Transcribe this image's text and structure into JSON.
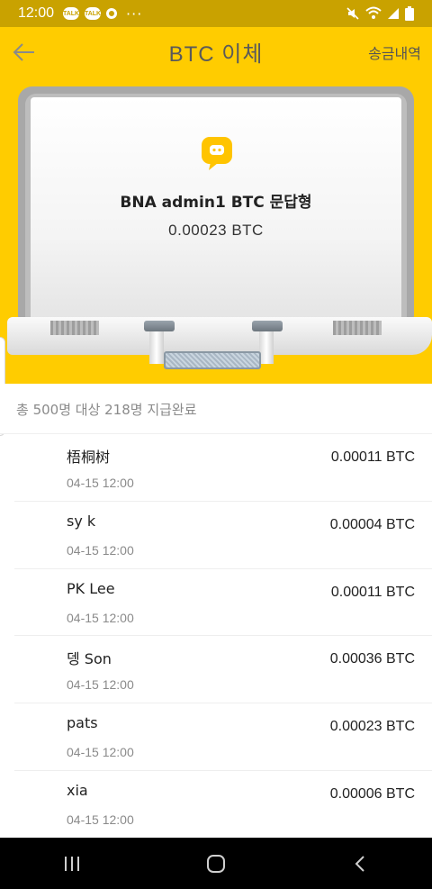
{
  "status": {
    "time": "12:00",
    "left_badges": [
      "TALK",
      "TALK"
    ],
    "dots": "···"
  },
  "header": {
    "title": "BTC 이체",
    "history_label": "송금내역"
  },
  "card": {
    "title": "BNA admin1  BTC  문답형",
    "amount": "0.00023  BTC",
    "logo_icon": "chat-bubble-b-icon",
    "accent_color": "#ffcc00"
  },
  "summary": "총 500명 대상 218명 지급완료",
  "recipients": [
    {
      "name": "梧桐树",
      "time": "04-15 12:00",
      "amount": "0.00011 BTC"
    },
    {
      "name": "sy k",
      "time": "04-15 12:00",
      "amount": "0.00004 BTC"
    },
    {
      "name": "PK Lee",
      "time": "04-15 12:00",
      "amount": "0.00011 BTC"
    },
    {
      "name": "뎅 Son",
      "time": "04-15 12:00",
      "amount": "0.00036 BTC"
    },
    {
      "name": "pats",
      "time": "04-15 12:00",
      "amount": "0.00023 BTC"
    },
    {
      "name": "xia",
      "time": "04-15 12:00",
      "amount": "0.00006 BTC"
    }
  ],
  "navbar": {
    "icons": [
      "recents-icon",
      "home-icon",
      "back-icon"
    ]
  }
}
